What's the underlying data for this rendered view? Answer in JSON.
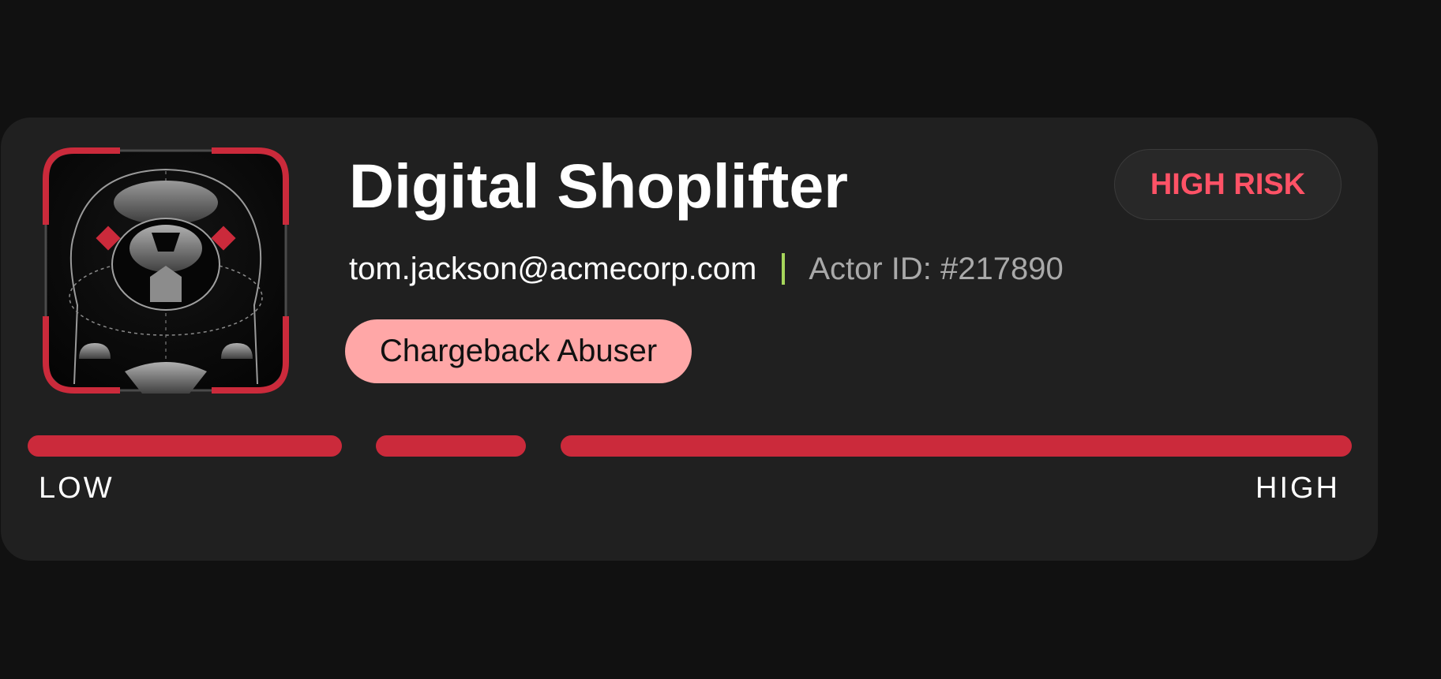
{
  "profile": {
    "title": "Digital Shoplifter",
    "risk_badge": "HIGH RISK",
    "email": "tom.jackson@acmecorp.com",
    "actor_id": "Actor ID: #217890",
    "tag": "Chargeback Abuser",
    "avatar_icon": "robot-mascot-icon"
  },
  "risk_meter": {
    "low_label": "LOW",
    "high_label": "HIGH",
    "level": "high"
  },
  "colors": {
    "background": "#111111",
    "card": "#202020",
    "accent_red": "#cb2a3b",
    "risk_text": "#ff5266",
    "tag_bg": "#ffa7a7",
    "divider": "#a6d65b"
  }
}
